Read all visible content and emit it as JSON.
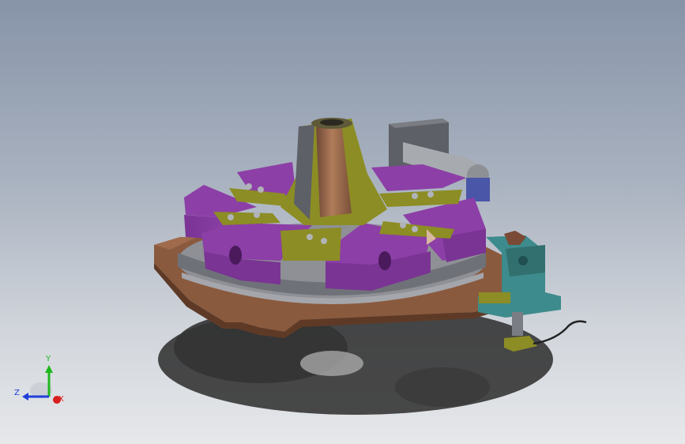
{
  "viewport": {
    "background_top": "#8794a8",
    "background_bottom": "#e6e8ea"
  },
  "model": {
    "colors": {
      "jaw": "#8c3fa6",
      "jaw_dark": "#6a2b80",
      "base_plate": "#8a5a3e",
      "ring": "#8e9096",
      "cone": "#9c6a4c",
      "bracket": "#8c8d24",
      "motor": "#5d6066",
      "cylinder": "#a7abb0",
      "sensor_bracket": "#3d8b8c",
      "shadow": "#1c1c1c"
    }
  },
  "triad": {
    "y_label": "Y",
    "z_label": "Z",
    "x_label": "X",
    "y_color": "#1fb81f",
    "z_color": "#1f3fd8",
    "x_color": "#d81f1f"
  }
}
